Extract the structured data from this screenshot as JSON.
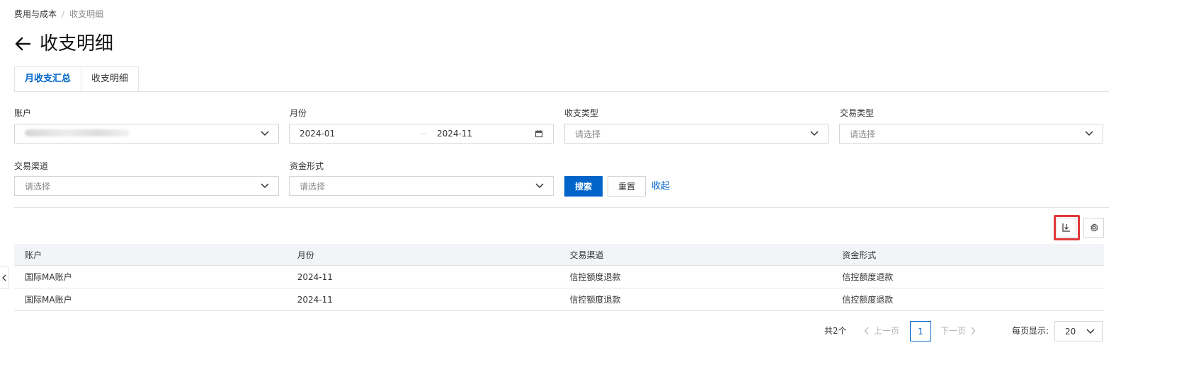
{
  "breadcrumb": {
    "parent": "费用与成本",
    "separator": "/",
    "current": "收支明细"
  },
  "page": {
    "title": "收支明细"
  },
  "tabs": [
    {
      "label": "月收支汇总",
      "active": true
    },
    {
      "label": "收支明细",
      "active": false
    }
  ],
  "filters": {
    "account": {
      "label": "账户",
      "value": ""
    },
    "month": {
      "label": "月份",
      "start": "2024-01",
      "end": "2024-11"
    },
    "income_type": {
      "label": "收支类型",
      "placeholder": "请选择"
    },
    "trade_type": {
      "label": "交易类型",
      "placeholder": "请选择"
    },
    "trade_channel": {
      "label": "交易渠道",
      "placeholder": "请选择"
    },
    "fund_form": {
      "label": "资金形式",
      "placeholder": "请选择"
    }
  },
  "actions": {
    "search": "搜索",
    "reset": "重置",
    "collapse": "收起"
  },
  "table": {
    "columns": [
      "账户",
      "月份",
      "交易渠道",
      "资金形式"
    ],
    "rows": [
      [
        "国际MA账户",
        "2024-11",
        "信控额度退款",
        "信控额度退款"
      ],
      [
        "国际MA账户",
        "2024-11",
        "信控额度退款",
        "信控额度退款"
      ]
    ]
  },
  "pagination": {
    "total": "共2个",
    "prev": "上一页",
    "next": "下一页",
    "current": "1",
    "page_size_label": "每页显示:",
    "page_size": "20"
  },
  "colors": {
    "primary": "#0064c8",
    "highlight": "#e0393a",
    "border": "#d5d5d5",
    "header_bg": "#f2f4f7"
  },
  "icons": {
    "back": "arrow-left-icon",
    "chevron": "chevron-down-icon",
    "calendar": "calendar-icon",
    "download": "download-icon",
    "settings": "gear-icon"
  }
}
